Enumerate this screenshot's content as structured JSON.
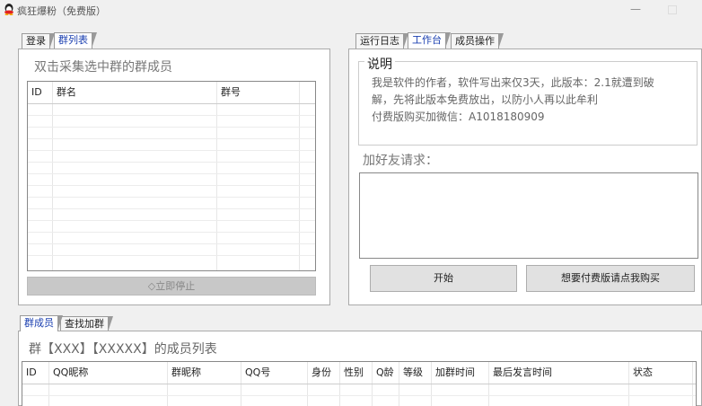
{
  "window": {
    "title": "疯狂爆粉（免费版）",
    "min_glyph": "—"
  },
  "left": {
    "tabs": [
      "登录",
      "群列表"
    ],
    "active_tab": 1,
    "hint": "双击采集选中群的群成员",
    "table": {
      "columns": [
        "ID",
        "群名",
        "群号"
      ]
    },
    "stop_button": "◇立即停止"
  },
  "right": {
    "tabs": [
      "运行日志",
      "工作台",
      "成员操作"
    ],
    "active_tab": 1,
    "desc_title": "说明",
    "desc_lines": [
      "我是软件的作者，软件写出来仅3天，此版本：2.1就遭到破",
      "解，先将此版本免费放出，以防小人再以此牟利",
      "付费版购买加微信：A1018180909"
    ],
    "friend_title": "加好友请求：",
    "friend_input_value": "",
    "start_button": "开始",
    "buy_button": "想要付费版请点我购买"
  },
  "bottom": {
    "tabs": [
      "群成员",
      "查找加群"
    ],
    "active_tab": 0,
    "hint": "群【XXX】【XXXXX】的成员列表",
    "table": {
      "columns": [
        "ID",
        "QQ昵称",
        "群昵称",
        "QQ号",
        "身份",
        "性别",
        "Q龄",
        "等级",
        "加群时间",
        "最后发言时间",
        "状态"
      ]
    }
  },
  "colors": {
    "active_tab_text": "#1a3fb0",
    "background": "#f0f0f0"
  }
}
